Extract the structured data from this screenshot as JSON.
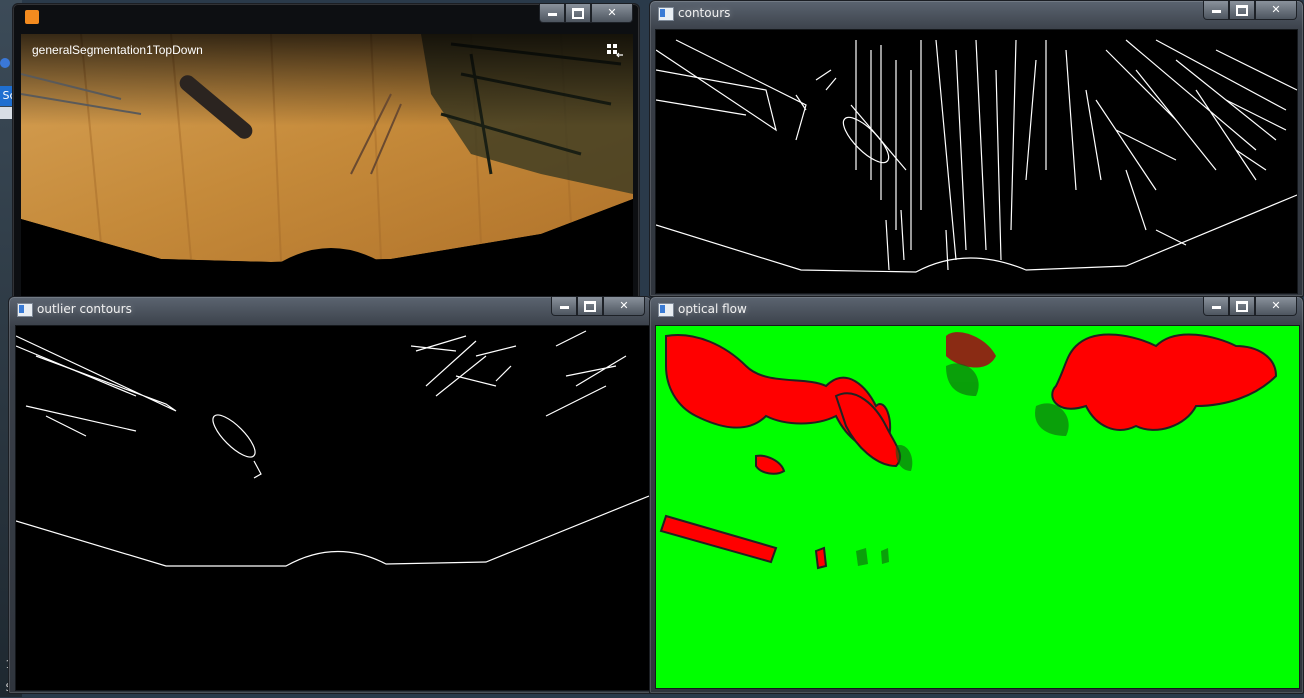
{
  "windows": {
    "video": {
      "title": "generalSegmentation1TopDown"
    },
    "contours": {
      "title": "contours"
    },
    "outlier": {
      "title": "outlier contours"
    },
    "flow": {
      "title": "optical flow"
    }
  },
  "desktop": {
    "left_badge_1": "Sc",
    "left_badge_2": "1",
    "left_badge_3": "S"
  },
  "colors": {
    "flow_background": "#00ff00",
    "flow_motion": "#ff0000",
    "contour_line": "#ffffff",
    "floor": "#c08a3c"
  },
  "controls": {
    "minimize": "minimize",
    "maximize": "maximize",
    "close": "close"
  }
}
